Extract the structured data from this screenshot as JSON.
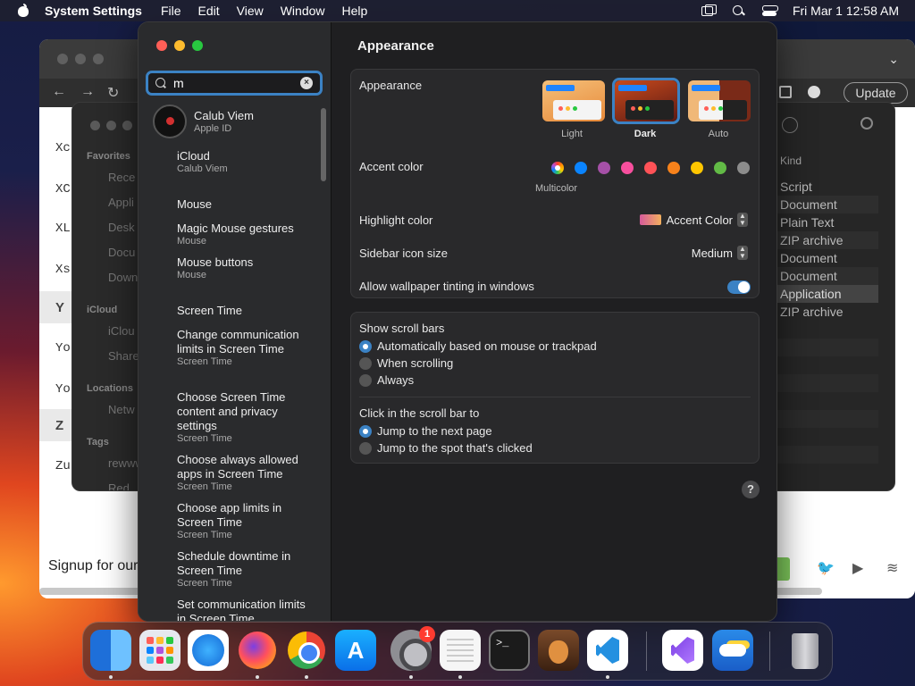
{
  "menubar": {
    "app_name": "System Settings",
    "menus": [
      "File",
      "Edit",
      "View",
      "Window",
      "Help"
    ],
    "clock": "Fri Mar 1  12:58 AM"
  },
  "background_browser": {
    "update_label": "Update",
    "letters": [
      "Xc",
      "XC",
      "XL",
      "Xs",
      "Y",
      "Yo",
      "Yo",
      "Z",
      "Zu"
    ],
    "signup_text": "Signup for our"
  },
  "background_finder": {
    "sidebar_sections": [
      "Favorites",
      "iCloud",
      "Locations",
      "Tags"
    ],
    "sidebar_items": [
      "Rece",
      "Appli",
      "Desk",
      "Docu",
      "Down",
      "iClou",
      "Share",
      "Netw",
      "rewww",
      "Red"
    ],
    "kind_header": "Kind",
    "kinds": [
      "Script",
      "Document",
      "Plain Text",
      "ZIP archive",
      "Document",
      "Document",
      "Application",
      "ZIP archive"
    ]
  },
  "settings": {
    "search": {
      "value": "m",
      "placeholder": "Search"
    },
    "results": [
      {
        "title": "Calub Viem",
        "subtitle": "Apple ID"
      },
      {
        "title": "iCloud",
        "subtitle": "Calub Viem"
      },
      {
        "title": "Mouse",
        "subtitle": ""
      },
      {
        "title": "Magic Mouse gestures",
        "subtitle": "Mouse"
      },
      {
        "title": "Mouse buttons",
        "subtitle": "Mouse"
      },
      {
        "title": "Screen Time",
        "subtitle": ""
      },
      {
        "title": "Change communication limits in Screen Time",
        "subtitle": "Screen Time"
      },
      {
        "title": "Choose Screen Time content and privacy settings",
        "subtitle": "Screen Time"
      },
      {
        "title": "Choose always allowed apps in Screen Time",
        "subtitle": "Screen Time"
      },
      {
        "title": "Choose app limits in Screen Time",
        "subtitle": "Screen Time"
      },
      {
        "title": "Schedule downtime in Screen Time",
        "subtitle": "Screen Time"
      },
      {
        "title": "Set communication limits in Screen Time",
        "subtitle": ""
      }
    ],
    "page_title": "Appearance",
    "appearance": {
      "label": "Appearance",
      "options": [
        "Light",
        "Dark",
        "Auto"
      ],
      "selected": "Dark"
    },
    "accent": {
      "label": "Accent color",
      "selected_label": "Multicolor",
      "colors": [
        "#0a84ff",
        "#a550a7",
        "#f74f9e",
        "#ff5257",
        "#f7821b",
        "#ffc600",
        "#62ba46",
        "#8c8c8c"
      ]
    },
    "highlight": {
      "label": "Highlight color",
      "value": "Accent Color"
    },
    "sidebar_icon_size": {
      "label": "Sidebar icon size",
      "value": "Medium"
    },
    "wallpaper_tinting": {
      "label": "Allow wallpaper tinting in windows",
      "enabled": true
    },
    "scroll_bars": {
      "label": "Show scroll bars",
      "options": [
        "Automatically based on mouse or trackpad",
        "When scrolling",
        "Always"
      ],
      "selected": "Automatically based on mouse or trackpad"
    },
    "click_scroll": {
      "label": "Click in the scroll bar to",
      "options": [
        "Jump to the next page",
        "Jump to the spot that's clicked"
      ],
      "selected": "Jump to the next page"
    },
    "help": "?"
  },
  "dock": {
    "settings_badge": "1"
  }
}
